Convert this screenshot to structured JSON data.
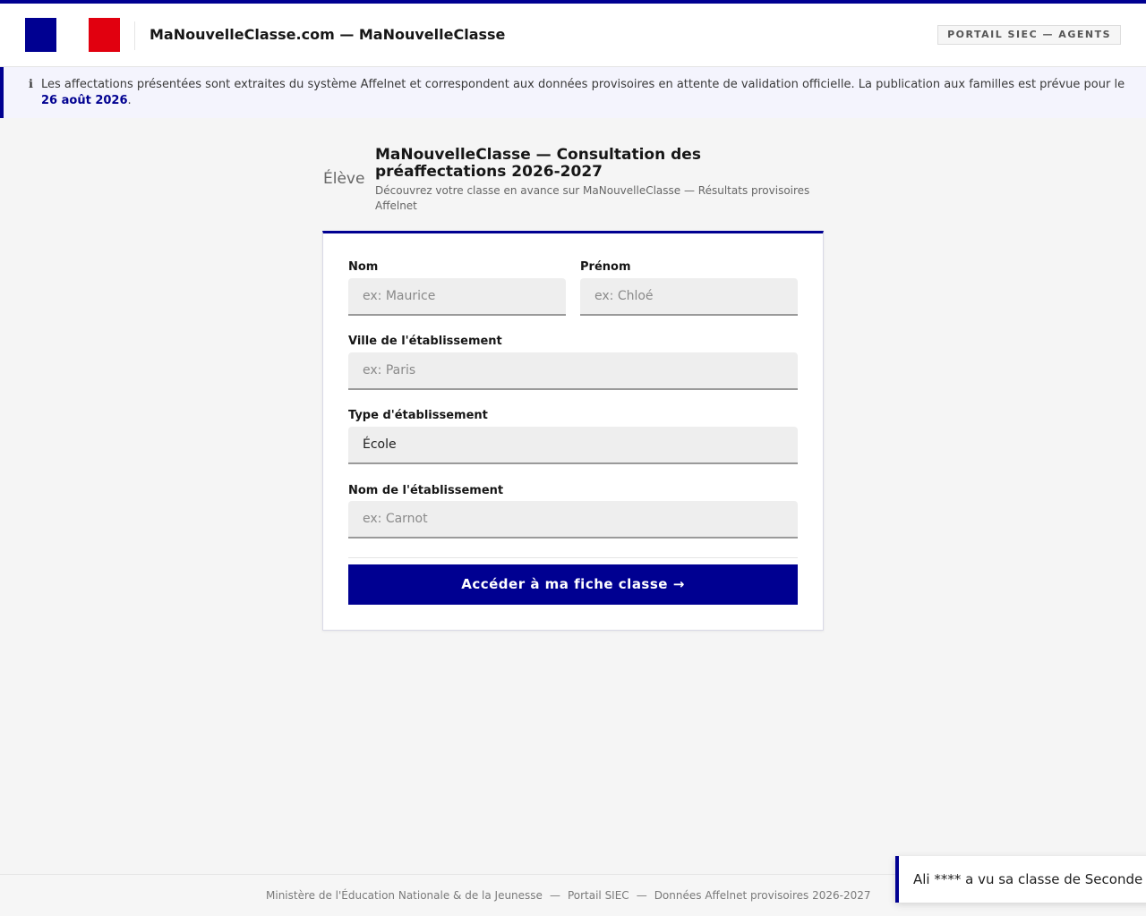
{
  "header": {
    "brand_title": "MaNouvelleClasse.com — MaNouvelleClasse",
    "portal_badge": "PORTAIL SIEC — AGENTS",
    "flag_colors": {
      "blue": "#000091",
      "white": "#ffffff",
      "red": "#e1000f"
    }
  },
  "notice": {
    "icon": "info-icon",
    "icon_glyph": "ℹ",
    "text_before": "Les affectations présentées sont extraites du système Affelnet et correspondent aux données provisoires en attente de validation officielle. La publication aux familles est prévue pour le ",
    "date": "26 août 2026",
    "text_after": "."
  },
  "page": {
    "eleve_label": "Élève",
    "title": "MaNouvelleClasse — Consultation des préaffectations 2026-2027",
    "subtitle": "Découvrez votre classe en avance sur MaNouvelleClasse — Résultats provisoires Affelnet"
  },
  "form": {
    "nom": {
      "label": "Nom",
      "value": "",
      "placeholder": "ex: Maurice"
    },
    "prenom": {
      "label": "Prénom",
      "value": "",
      "placeholder": "ex: Chloé"
    },
    "ville": {
      "label": "Ville de l'établissement",
      "value": "",
      "placeholder": "ex: Paris"
    },
    "type": {
      "label": "Type d'établissement",
      "selected": "École"
    },
    "etablissement": {
      "label": "Nom de l'établissement",
      "value": "",
      "placeholder": "ex: Carnot"
    },
    "submit_label": "Accéder à ma fiche classe →"
  },
  "footer": {
    "part1": "Ministère de l'Éducation Nationale & de la Jeunesse",
    "part2": "Portail SIEC",
    "part3": "Données Affelnet provisoires 2026-2027",
    "separator": "—"
  },
  "toast": {
    "text": "Ali **** a vu sa classe de Seconde"
  },
  "colors": {
    "accent": "#000091",
    "background": "#f5f5f5",
    "field_bg": "#eeeeee"
  }
}
